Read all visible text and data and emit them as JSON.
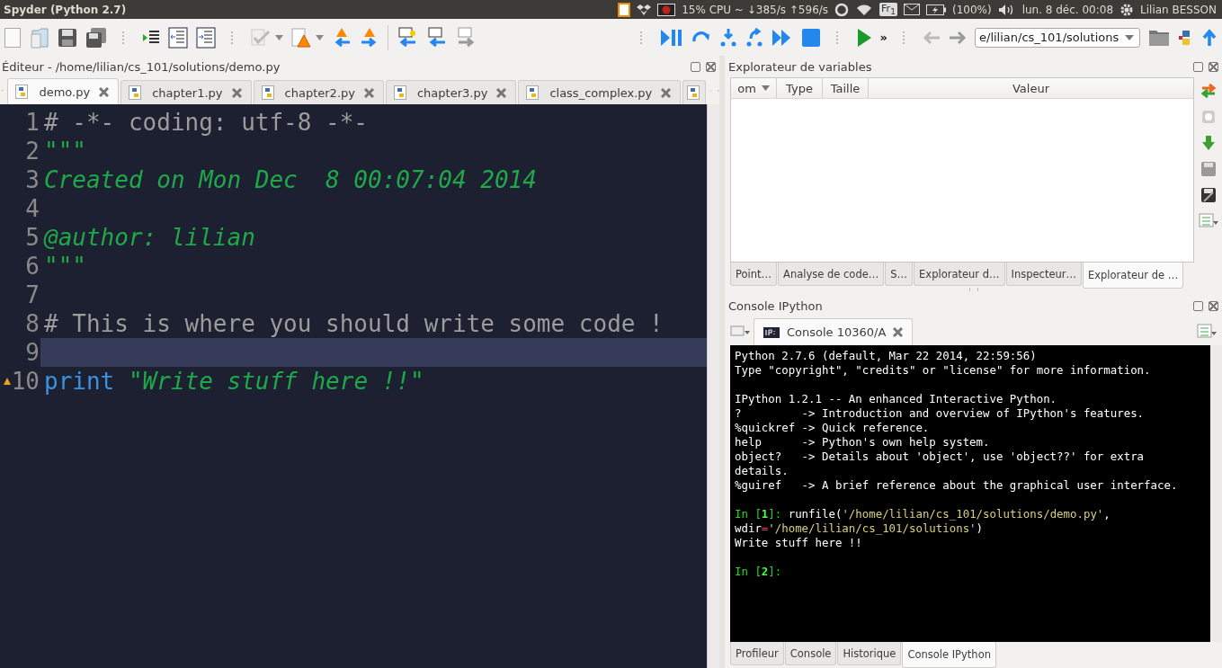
{
  "window": {
    "title": "Spyder (Python 2.7)"
  },
  "indicators": {
    "cpu": "15% CPU ~ ↓385/s ↑596/s",
    "keyboard": "Fr$_{1}$",
    "battery": "(100%)",
    "clock": "lun.  8 déc. 00:08",
    "user": "Lilian BESSON"
  },
  "toolbar": {
    "overflow": "»",
    "path": "e/lilian/cs_101/solutions"
  },
  "editor": {
    "title": "Éditeur - /home/lilian/cs_101/solutions/demo.py",
    "tabs": [
      {
        "label": "demo.py",
        "selected": true
      },
      {
        "label": "chapter1.py",
        "selected": false
      },
      {
        "label": "chapter2.py",
        "selected": false
      },
      {
        "label": "chapter3.py",
        "selected": false
      },
      {
        "label": "class_complex.py",
        "selected": false
      }
    ],
    "lines": [
      {
        "number": "1",
        "current": false,
        "warning": false,
        "tokens": [
          {
            "text": "# -*- coding: utf-8 -*-",
            "kind": "comment"
          }
        ]
      },
      {
        "number": "2",
        "current": false,
        "warning": false,
        "tokens": [
          {
            "text": "\"\"\"",
            "kind": "string"
          }
        ]
      },
      {
        "number": "3",
        "current": false,
        "warning": false,
        "tokens": [
          {
            "text": "Created on Mon Dec  8 00:07:04 2014",
            "kind": "string"
          }
        ]
      },
      {
        "number": "4",
        "current": false,
        "warning": false
      },
      {
        "number": "5",
        "current": false,
        "warning": false,
        "tokens": [
          {
            "text": "@author: lilian",
            "kind": "string"
          }
        ]
      },
      {
        "number": "6",
        "current": false,
        "warning": false,
        "tokens": [
          {
            "text": "\"\"\"",
            "kind": "string"
          }
        ]
      },
      {
        "number": "7",
        "current": false,
        "warning": false
      },
      {
        "number": "8",
        "current": false,
        "warning": false,
        "tokens": [
          {
            "text": "# This is where you should write some code !",
            "kind": "comment"
          }
        ]
      },
      {
        "number": "9",
        "current": true,
        "warning": false
      },
      {
        "number": "10",
        "current": false,
        "warning": true,
        "tokens": [
          {
            "text": "print",
            "kind": "keyword"
          },
          {
            "text": " \"Write stuff here !!\"",
            "kind": "string"
          }
        ]
      }
    ]
  },
  "variable_explorer": {
    "title": "Explorateur de variables",
    "columns": [
      "om",
      "Type",
      "Taille",
      "Valeur"
    ],
    "tabs": [
      {
        "label": "Point…",
        "selected": false
      },
      {
        "label": "Analyse de code…",
        "selected": false
      },
      {
        "label": "S…",
        "selected": false
      },
      {
        "label": "Explorateur d…",
        "selected": false
      },
      {
        "label": "Inspecteur…",
        "selected": false
      },
      {
        "label": "Explorateur de …",
        "selected": true
      }
    ]
  },
  "console": {
    "title": "Console IPython",
    "tab": "Console 10360/A",
    "blocks": [
      [
        [
          {
            "text": "Python 2.7.6 (default, Mar 22 2014, 22:59:56)",
            "kind": "plain"
          }
        ],
        [
          {
            "text": "Type \"copyright\", \"credits\" or \"license\" for more information.",
            "kind": "plain"
          }
        ]
      ],
      [
        [
          {
            "text": "IPython 1.2.1 -- An enhanced Interactive Python.",
            "kind": "plain"
          }
        ],
        [
          {
            "text": "?         -> Introduction and overview of IPython's features.",
            "kind": "plain"
          }
        ],
        [
          {
            "text": "%quickref -> Quick reference.",
            "kind": "plain"
          }
        ],
        [
          {
            "text": "help      -> Python's own help system.",
            "kind": "plain"
          }
        ],
        [
          {
            "text": "object?   -> Details about 'object', use 'object??' for extra",
            "kind": "plain"
          }
        ],
        [
          {
            "text": "details.",
            "kind": "plain"
          }
        ],
        [
          {
            "text": "%guiref   -> A brief reference about the graphical user interface.",
            "kind": "plain"
          }
        ]
      ],
      [
        [
          {
            "text": "In [",
            "kind": "prompt"
          },
          {
            "text": "1",
            "kind": "prompt-number"
          },
          {
            "text": "]: ",
            "kind": "prompt"
          },
          {
            "text": "runfile(",
            "kind": "plain"
          },
          {
            "text": "'/home/lilian/cs_101/solutions/demo.py'",
            "kind": "string"
          },
          {
            "text": ",",
            "kind": "plain"
          }
        ],
        [
          {
            "text": "wdir",
            "kind": "plain"
          },
          {
            "text": "=",
            "kind": "operator"
          },
          {
            "text": "'/home/lilian/cs_101/solutions'",
            "kind": "string"
          },
          {
            "text": ")",
            "kind": "plain"
          }
        ],
        [
          {
            "text": "Write stuff here !!",
            "kind": "plain"
          }
        ]
      ],
      [
        [
          {
            "text": "In [",
            "kind": "prompt"
          },
          {
            "text": "2",
            "kind": "prompt-number"
          },
          {
            "text": "]:",
            "kind": "prompt"
          }
        ]
      ]
    ],
    "tabs": [
      {
        "label": "Profileur",
        "selected": false
      },
      {
        "label": "Console",
        "selected": false
      },
      {
        "label": "Historique",
        "selected": false
      },
      {
        "label": "Console IPython",
        "selected": true
      }
    ]
  }
}
